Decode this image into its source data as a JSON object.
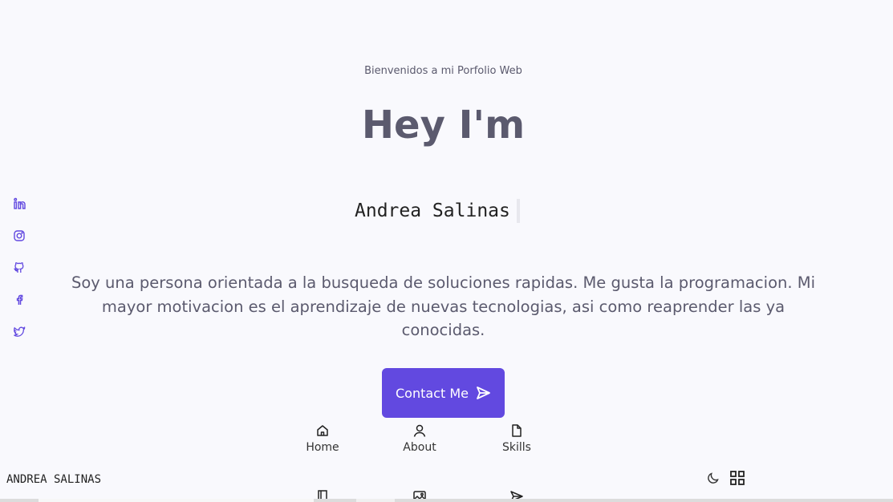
{
  "hero": {
    "subtitle": "Bienvenidos a mi Porfolio Web",
    "title": "Hey I'm",
    "name": "Andrea Salinas",
    "description": "Soy una persona orientada a la busqueda de soluciones rapidas. Me gusta la programacion. Mi mayor motivacion es el aprendizaje de nuevas tecnologias, asi como reaprender las ya conocidas.",
    "contact_label": "Contact Me"
  },
  "social": [
    "linkedin-icon",
    "instagram-icon",
    "github-icon",
    "facebook-icon",
    "twitter-icon"
  ],
  "nav": {
    "items": [
      {
        "label": "Home",
        "icon": "home-icon"
      },
      {
        "label": "About",
        "icon": "user-icon"
      },
      {
        "label": "Skills",
        "icon": "file-icon"
      },
      {
        "label": "",
        "icon": "book-icon"
      },
      {
        "label": "",
        "icon": "image-icon"
      },
      {
        "label": "",
        "icon": "send-icon"
      }
    ]
  },
  "footer": {
    "brand": "ANDREA SALINAS",
    "theme_icon": "moon-icon",
    "menu_icon": "apps-icon"
  },
  "colors": {
    "accent": "#6249e0",
    "text": "#5b5a6e",
    "background": "#f9f9fd"
  }
}
